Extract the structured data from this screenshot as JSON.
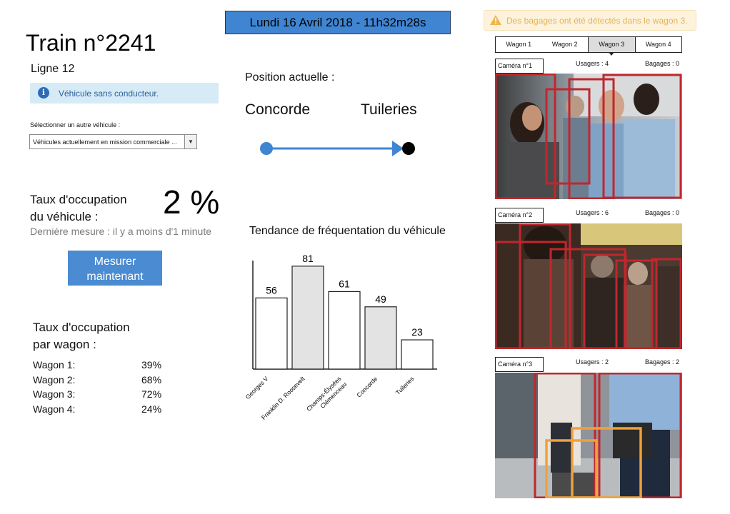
{
  "header": {
    "datetime": "Lundi 16 Avril 2018 - 11h32m28s"
  },
  "train": {
    "title": "Train n°2241",
    "line": "Ligne 12",
    "info_message": "Véhicule sans conducteur.",
    "select_label": "Sélectionner un autre véhicule :",
    "select_value": "Véhicules actuellement en mission commerciale ..."
  },
  "occupancy": {
    "label_line1": "Taux d'occupation",
    "label_line2": "du véhicule :",
    "value": "2 %",
    "last_measure": "Dernière mesure : il y a moins d'1 minute",
    "measure_button_line1": "Mesurer",
    "measure_button_line2": "maintenant"
  },
  "wagon_occupancy": {
    "title_line1": "Taux d'occupation",
    "title_line2": "par wagon :",
    "rows": [
      {
        "name": "Wagon 1:",
        "value": "39%"
      },
      {
        "name": "Wagon 2:",
        "value": "68%"
      },
      {
        "name": "Wagon 3:",
        "value": "72%"
      },
      {
        "name": "Wagon 4:",
        "value": "24%"
      }
    ]
  },
  "position": {
    "label": "Position actuelle :",
    "from": "Concorde",
    "to": "Tuileries",
    "line_color": "#3f85d1"
  },
  "chart_title": "Tendance de fréquentation du véhicule",
  "chart_data": {
    "type": "bar",
    "categories": [
      "Georges V",
      "Franklin D. Roosevelt",
      "Champs-Élysées Clémenceau",
      "Concorde",
      "Tuileries"
    ],
    "category_lines": [
      [
        "Georges V"
      ],
      [
        "Franklin D. Roosevelt"
      ],
      [
        "Champs-Élysées",
        "Clémenceau"
      ],
      [
        "Concorde"
      ],
      [
        "Tuileries"
      ]
    ],
    "values": [
      56,
      81,
      61,
      49,
      23
    ],
    "fills": [
      "#ffffff",
      "#e3e3e3",
      "#ffffff",
      "#e3e3e3",
      "#ffffff"
    ],
    "title": "Tendance de fréquentation du véhicule",
    "xlabel": "",
    "ylabel": "",
    "ylim": [
      0,
      100
    ],
    "grid": false,
    "data_labels": true
  },
  "alert": {
    "icon": "warning-icon",
    "text": "Des bagages ont été détectés dans le wagon 3.",
    "color": "#e3b45a"
  },
  "wagon_tabs": {
    "items": [
      "Wagon 1",
      "Wagon 2",
      "Wagon 3",
      "Wagon 4"
    ],
    "active_index": 2
  },
  "cameras": [
    {
      "label": "Caméra n°1",
      "users": "Usagers : 4",
      "bags": "Bagages : 0"
    },
    {
      "label": "Caméra n°2",
      "users": "Usagers : 6",
      "bags": "Bagages : 0"
    },
    {
      "label": "Caméra n°3",
      "users": "Usagers : 2",
      "bags": "Bagages : 2"
    }
  ],
  "colors": {
    "accent_blue": "#3f85d1",
    "button_blue": "#4a8bd1",
    "person_box": "#c0272d",
    "bag_box": "#f0a13a"
  }
}
